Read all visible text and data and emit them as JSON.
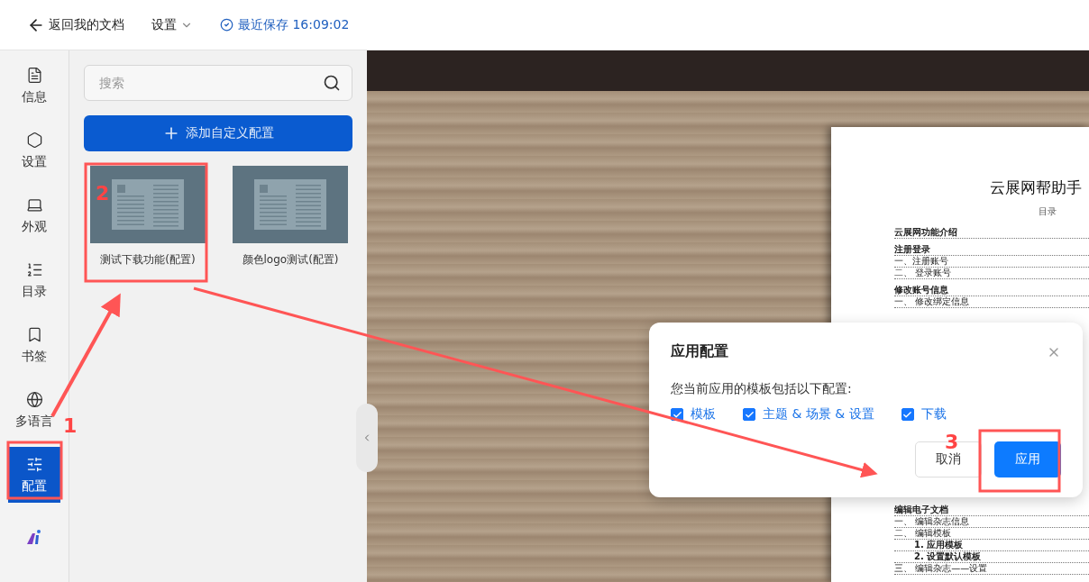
{
  "topbar": {
    "back": "返回我的文档",
    "settings_menu": "设置",
    "save_status": "最近保存 16:09:02"
  },
  "rail": {
    "items": [
      {
        "label": "信息",
        "selected": false
      },
      {
        "label": "设置",
        "selected": false
      },
      {
        "label": "外观",
        "selected": false
      },
      {
        "label": "目录",
        "selected": false
      },
      {
        "label": "书签",
        "selected": false
      },
      {
        "label": "多语言",
        "selected": false
      },
      {
        "label": "配置",
        "selected": true
      }
    ]
  },
  "panel": {
    "search": {
      "placeholder": "搜索"
    },
    "add_button": "添加自定义配置",
    "cards": [
      {
        "label": "测试下载功能(配置)"
      },
      {
        "label": "颜色logo测试(配置)"
      }
    ]
  },
  "document": {
    "title": "云展网帮助手",
    "toc_heading": "目录",
    "toc_top": [
      {
        "text": "云展网功能介绍",
        "kind": "section"
      },
      {
        "text": "注册登录",
        "kind": "section"
      },
      {
        "text": "一、注册账号",
        "kind": "item"
      },
      {
        "text": "二、 登录账号",
        "kind": "item"
      },
      {
        "text": "修改账号信息",
        "kind": "section"
      },
      {
        "text": "一、 修改绑定信息",
        "kind": "item"
      }
    ],
    "toc_bottom": [
      {
        "text": "编辑电子文档",
        "kind": "section"
      },
      {
        "text": "一、 编辑杂志信息",
        "kind": "item"
      },
      {
        "text": "二、 编辑模板",
        "kind": "item"
      },
      {
        "text": "1. 应用模板",
        "kind": "sub"
      },
      {
        "text": "2. 设置默认模板",
        "kind": "sub"
      },
      {
        "text": "三、 编辑杂志——设置",
        "kind": "item"
      }
    ]
  },
  "dialog": {
    "title": "应用配置",
    "message": "您当前应用的模板包括以下配置:",
    "options": [
      {
        "label": "模板",
        "checked": true
      },
      {
        "label": "主题 & 场景 & 设置",
        "checked": true
      },
      {
        "label": "下载",
        "checked": true
      }
    ],
    "cancel": "取消",
    "confirm": "应用"
  },
  "annotations": [
    "1",
    "2",
    "3"
  ]
}
